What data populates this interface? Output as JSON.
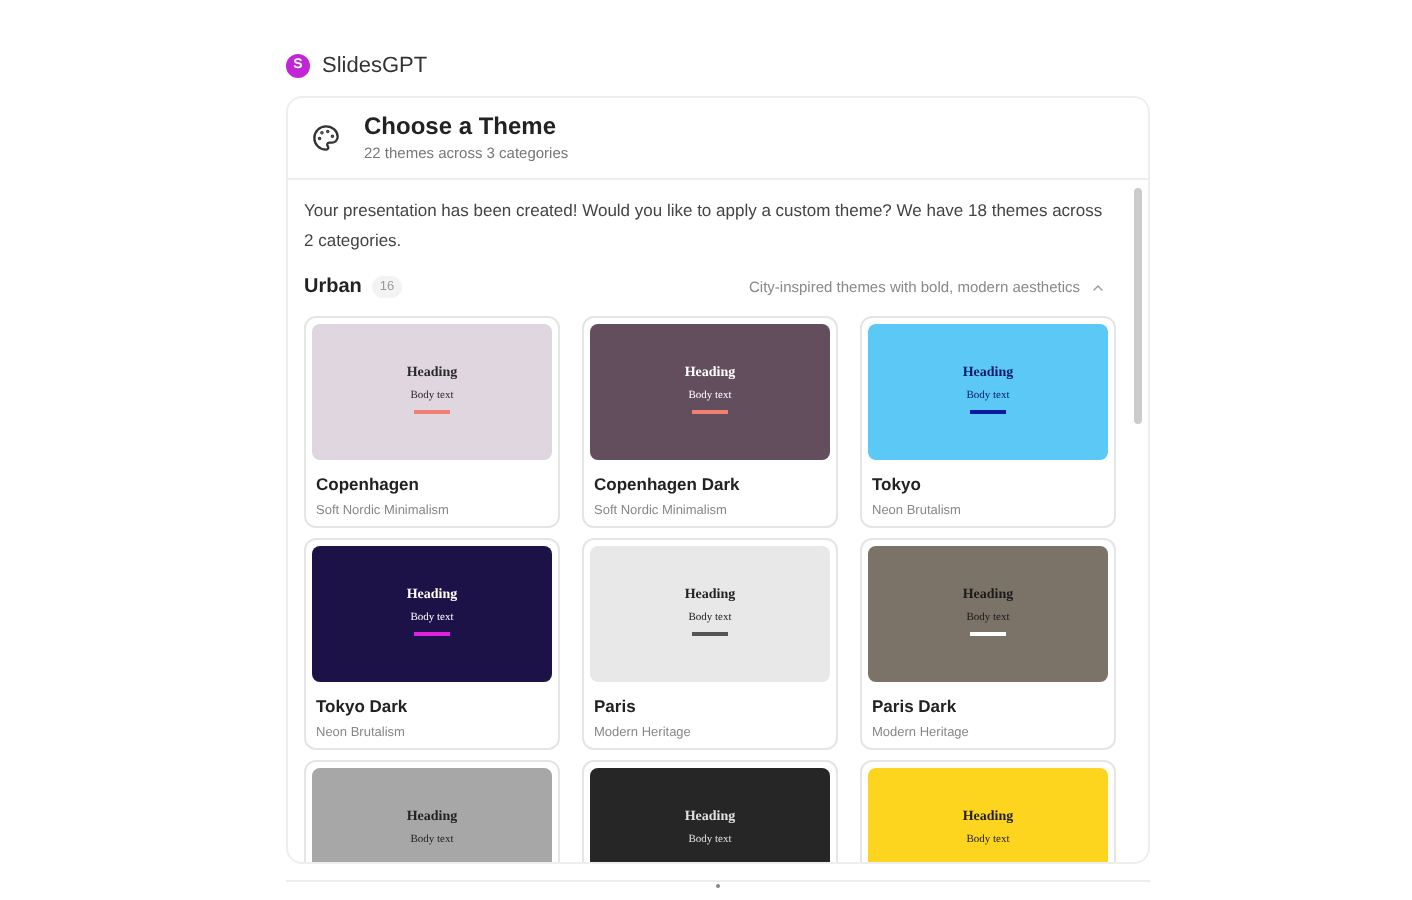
{
  "app": {
    "logo_letter": "S",
    "name": "SlidesGPT"
  },
  "panel": {
    "title": "Choose a Theme",
    "subtitle": "22 themes across 3 categories"
  },
  "message": "Your presentation has been created! Would you like to apply a custom theme? We have 18 themes across 2 categories.",
  "category": {
    "name": "Urban",
    "count": "16",
    "description": "City-inspired themes with bold, modern aesthetics",
    "expanded": true
  },
  "themes": [
    {
      "name": "Copenhagen",
      "subtitle": "Soft Nordic Minimalism",
      "color": "#dfd6df",
      "heading": {
        "text": "Heading",
        "color": "#2a2a2a"
      },
      "body": "Body text",
      "accent_line": {
        "color": "#f08070"
      }
    },
    {
      "name": "Copenhagen Dark",
      "subtitle": "Soft Nordic Minimalism",
      "color": "#634e5e",
      "heading": {
        "text": "Heading",
        "color": "#ffffff"
      },
      "body": "Body text",
      "accent_line": {
        "color": "#f08070"
      }
    },
    {
      "name": "Tokyo",
      "subtitle": "Neon Brutalism",
      "color": "#5bc8f5",
      "heading": {
        "text": "Heading",
        "color": "#0a1a6a"
      },
      "body": "Body text",
      "accent_line": {
        "color": "#0a1aa0"
      }
    },
    {
      "name": "Tokyo Dark",
      "subtitle": "Neon Brutalism",
      "color": "#1c1248",
      "heading": {
        "text": "Heading",
        "color": "#ffffff"
      },
      "body": "Body text",
      "accent_line": {
        "color": "#e020e0"
      }
    },
    {
      "name": "Paris",
      "subtitle": "Modern Heritage",
      "color": "#e8e8e8",
      "heading": {
        "text": "Heading",
        "color": "#222222"
      },
      "body": "Body text",
      "accent_line": {
        "color": "#555555"
      }
    },
    {
      "name": "Paris Dark",
      "subtitle": "Modern Heritage",
      "color": "#7b7367",
      "heading": {
        "text": "Heading",
        "color": "#1a1a1a"
      },
      "body": "Body text",
      "accent_line": {
        "color": "#ffffff"
      }
    },
    {
      "color": "#a7a7a7",
      "heading": {
        "text": "Heading",
        "color": "#222222"
      },
      "body": "Body text"
    },
    {
      "color": "#262626",
      "heading": {
        "text": "Heading",
        "color": "#e0e0e0"
      },
      "body": "Body text"
    },
    {
      "color": "#fdd41e",
      "heading": {
        "text": "Heading",
        "color": "#222222"
      },
      "body": "Body text"
    }
  ]
}
